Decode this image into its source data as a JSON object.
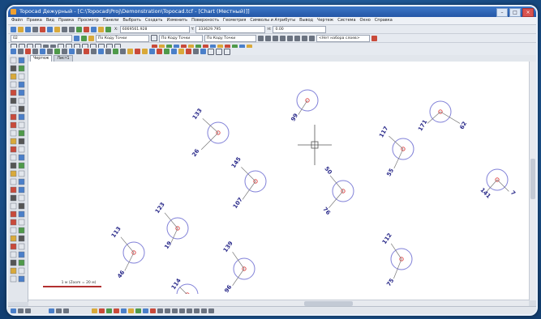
{
  "window": {
    "title": "Topocad Дежурный - [C:\\Topocad\\Proj\\Demonstration\\Topocad.tcf - [Chart (Местный)]]"
  },
  "menu": [
    "Файл",
    "Правка",
    "Вид",
    "Правка",
    "Просмотр",
    "Панели",
    "Выбрать",
    "Создать",
    "Изменить",
    "Поверхность",
    "Геометрия",
    "Символы и Атрибуты",
    "Вывод",
    "Чертеж",
    "Система",
    "Окно",
    "Справка"
  ],
  "toolbar1": {
    "coord_x": "6069561.928",
    "coord_y_label": "Y:",
    "coord_y": "333629.795",
    "z_label": "Н:",
    "z_value": "0.00"
  },
  "toolbar2": {
    "layer": "02",
    "layer_code_a": "По Коду Точки",
    "layer_code_b": "По Коду Точки",
    "line_code": "По Коду Точки",
    "set_select": "<Нет набора слоев>"
  },
  "tabs": [
    "Чертеж",
    "Лист1"
  ],
  "scalebar_label": "1 м (Zoom = 20 м)",
  "points": [
    {
      "azimuth": "99",
      "distance": ""
    },
    {
      "azimuth": "133",
      "distance": "26"
    },
    {
      "azimuth": "171",
      "distance": "62"
    },
    {
      "azimuth": "117",
      "distance": "55"
    },
    {
      "azimuth": "145",
      "distance": "107"
    },
    {
      "azimuth": "50",
      "distance": "76"
    },
    {
      "azimuth": "141",
      "distance": "7"
    },
    {
      "azimuth": "123",
      "distance": "19"
    },
    {
      "azimuth": "113",
      "distance": "46"
    },
    {
      "azimuth": "139",
      "distance": "96"
    },
    {
      "azimuth": "112",
      "distance": "75"
    },
    {
      "azimuth": "114",
      "distance": ""
    }
  ],
  "colors": {
    "point_ring": "#8080d8",
    "point_center": "#e05050",
    "label": "#2a2a8a",
    "crosshair": "#555555",
    "title_bar": "#2456a6"
  }
}
